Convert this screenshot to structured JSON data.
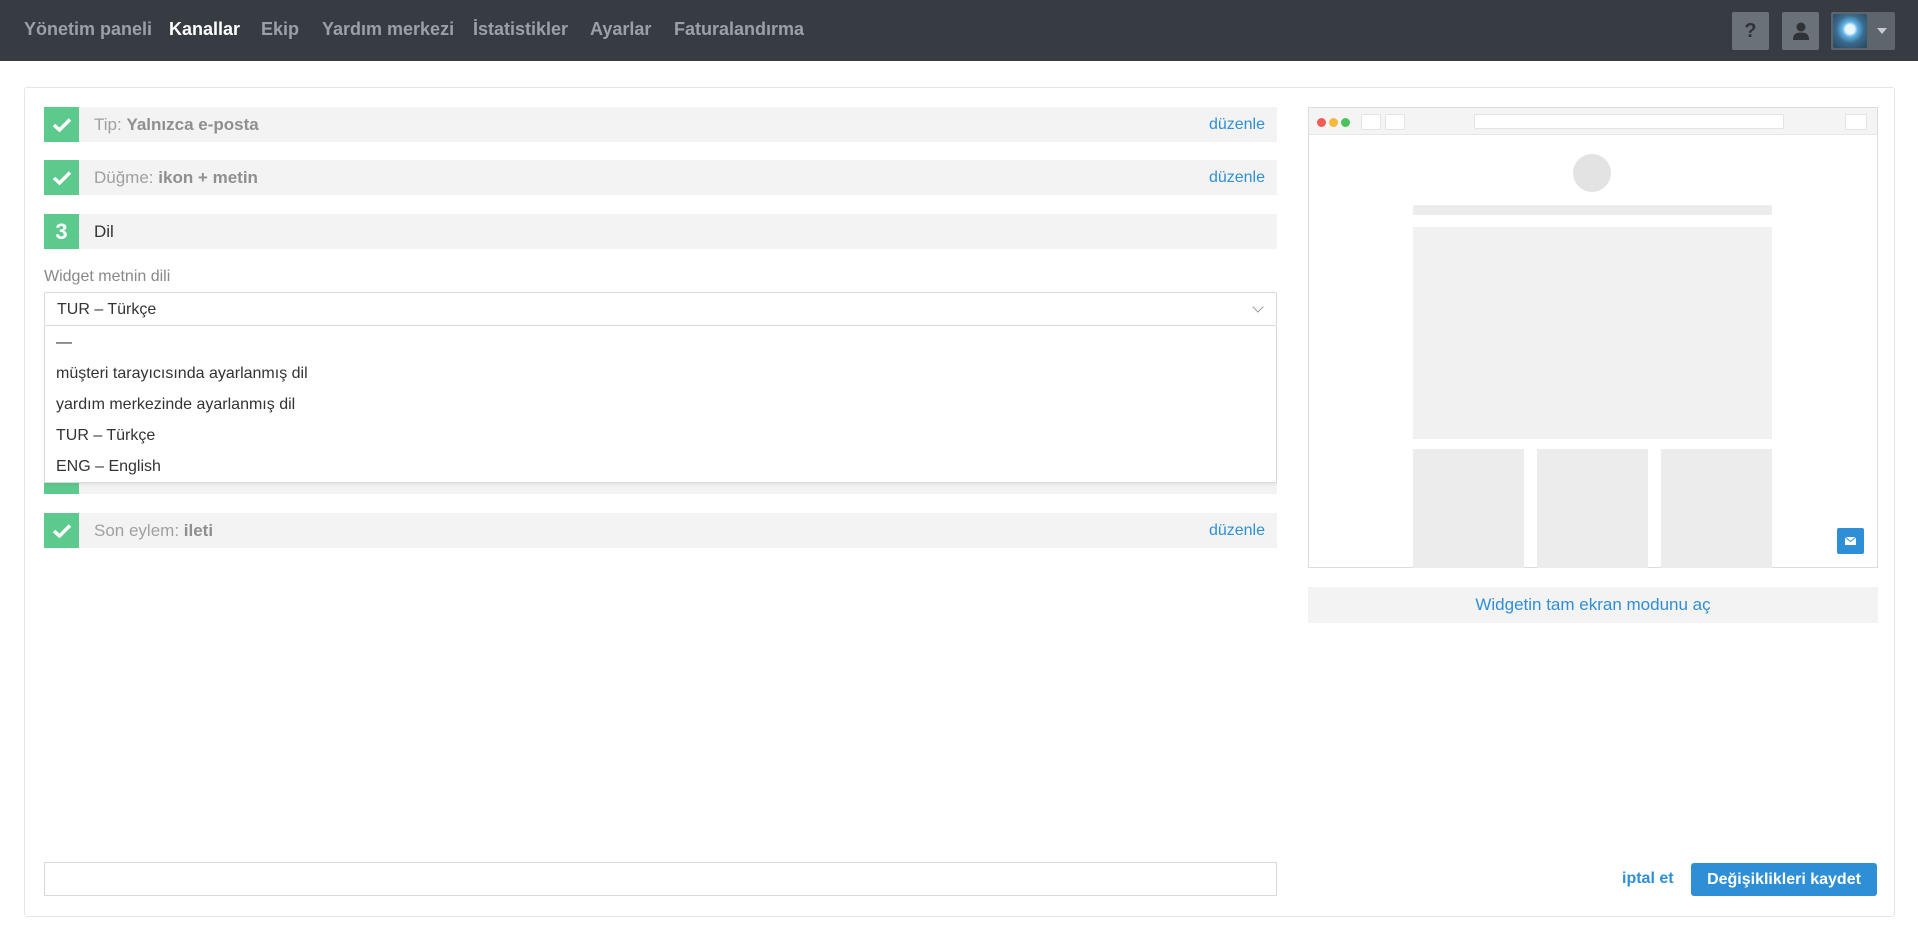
{
  "nav": {
    "items": [
      {
        "label": "Yönetim paneli",
        "active": false
      },
      {
        "label": "Kanallar",
        "active": true
      },
      {
        "label": "Ekip",
        "active": false
      },
      {
        "label": "Yardım merkezi",
        "active": false
      },
      {
        "label": "İstatistikler",
        "active": false
      },
      {
        "label": "Ayarlar",
        "active": false
      },
      {
        "label": "Faturalandırma",
        "active": false
      }
    ],
    "help_label": "?",
    "icons": {
      "help": "question-icon",
      "user": "user-icon",
      "avatar": "avatar-image",
      "caret": "caret-down-icon"
    }
  },
  "steps": [
    {
      "prefix": "Tip:",
      "value": "Yalnızca e-posta",
      "edit": "düzenle"
    },
    {
      "prefix": "Düğme:",
      "value": "ikon + metin",
      "edit": "düzenle"
    },
    {
      "number": "3",
      "title": "Dil"
    },
    {
      "prefix": "Son eylem:",
      "value": "ileti",
      "edit": "düzenle"
    }
  ],
  "language": {
    "label": "Widget metnin dili",
    "selected": "TUR – Türkçe",
    "options": [
      "—",
      "müşteri tarayıcısında ayarlanmış dil",
      "yardım merkezinde ayarlanmış dil",
      "TUR – Türkçe",
      "ENG – English"
    ]
  },
  "preview": {
    "fullscreen_label": "Widgetin tam ekran modunu aç",
    "dot_colors": [
      "#f25c54",
      "#f5b83d",
      "#4cc35a"
    ],
    "accent": "#2f8fd6"
  },
  "footer": {
    "cancel_label": "iptal et",
    "save_label": "Değişiklikleri kaydet"
  },
  "colors": {
    "navbar_bg": "#373c43",
    "success": "#5cc98d",
    "link": "#2f8fd6"
  }
}
